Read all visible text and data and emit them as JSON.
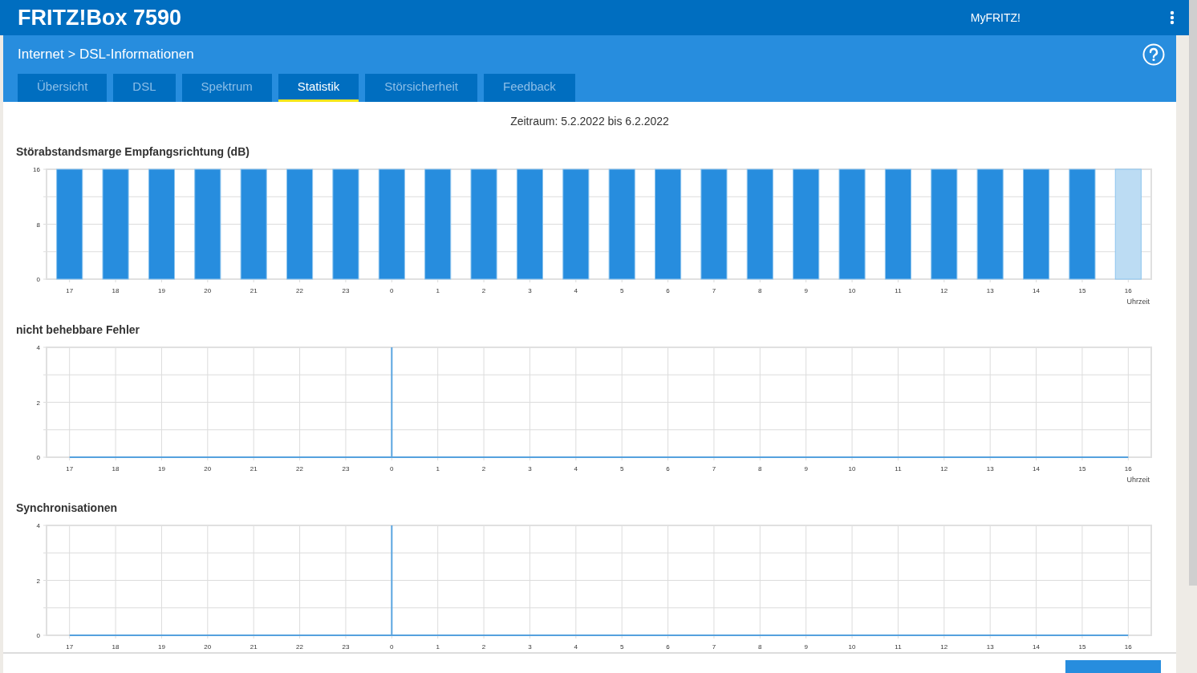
{
  "header": {
    "title": "FRITZ!Box 7590",
    "myfritz": "MyFRITZ!"
  },
  "breadcrumb": {
    "parent": "Internet",
    "separator": ">",
    "current": "DSL-Informationen"
  },
  "tabs": [
    {
      "label": "Übersicht",
      "selected": false
    },
    {
      "label": "DSL",
      "selected": false
    },
    {
      "label": "Spektrum",
      "selected": false
    },
    {
      "label": "Statistik",
      "selected": true
    },
    {
      "label": "Störsicherheit",
      "selected": false
    },
    {
      "label": "Feedback",
      "selected": false
    }
  ],
  "period": "Zeitraum: 5.2.2022 bis 6.2.2022",
  "charts": [
    {
      "chart_data": {
        "type": "bar",
        "title": "Störabstandsmarge Empfangsrichtung (dB)",
        "xlabel": "Uhrzeit",
        "stacked": true,
        "grid": true,
        "categories": [
          "17",
          "18",
          "19",
          "20",
          "21",
          "22",
          "23",
          "0",
          "1",
          "2",
          "3",
          "4",
          "5",
          "6",
          "7",
          "8",
          "9",
          "10",
          "11",
          "12",
          "13",
          "14",
          "15",
          "16"
        ],
        "ylim": [
          0,
          16
        ],
        "yticks": [
          0,
          8,
          16
        ],
        "series": [
          {
            "color": "#278dde",
            "values": [
              16,
              16,
              16,
              16,
              16,
              16,
              16,
              16,
              16,
              16,
              16,
              16,
              16,
              16,
              16,
              16,
              16,
              16,
              16,
              16,
              16,
              16,
              16,
              null
            ]
          },
          {
            "color": "#bcdcf3",
            "values": [
              null,
              null,
              null,
              null,
              null,
              null,
              null,
              null,
              null,
              null,
              null,
              null,
              null,
              null,
              null,
              null,
              null,
              null,
              null,
              null,
              null,
              null,
              null,
              16
            ]
          }
        ]
      }
    },
    {
      "chart_data": {
        "type": "line",
        "title": "nicht behebbare Fehler",
        "xlabel": "Uhrzeit",
        "grid": true,
        "categories": [
          "17",
          "18",
          "19",
          "20",
          "21",
          "22",
          "23",
          "0",
          "1",
          "2",
          "3",
          "4",
          "5",
          "6",
          "7",
          "8",
          "9",
          "10",
          "11",
          "12",
          "13",
          "14",
          "15",
          "16"
        ],
        "ylim": [
          0,
          4
        ],
        "yticks": [
          0,
          2,
          4
        ],
        "values": [
          0,
          0,
          0,
          0,
          0,
          0,
          0,
          0,
          0,
          0,
          0,
          0,
          0,
          0,
          0,
          0,
          0,
          0,
          0,
          0,
          0,
          0,
          0,
          0
        ],
        "ref_lines": [
          {
            "axis": "x",
            "value": "0",
            "color": "#5aa5e0"
          }
        ]
      }
    },
    {
      "chart_data": {
        "type": "line",
        "title": "Synchronisationen",
        "grid": true,
        "categories": [
          "17",
          "18",
          "19",
          "20",
          "21",
          "22",
          "23",
          "0",
          "1",
          "2",
          "3",
          "4",
          "5",
          "6",
          "7",
          "8",
          "9",
          "10",
          "11",
          "12",
          "13",
          "14",
          "15",
          "16"
        ],
        "ylim": [
          0,
          4
        ],
        "yticks": [
          0,
          2,
          4
        ],
        "values": [
          0,
          0,
          0,
          0,
          0,
          0,
          0,
          0,
          0,
          0,
          0,
          0,
          0,
          0,
          0,
          0,
          0,
          0,
          0,
          0,
          0,
          0,
          0,
          0
        ],
        "ref_lines": [
          {
            "axis": "x",
            "value": "0",
            "color": "#5aa5e0"
          }
        ]
      }
    }
  ]
}
